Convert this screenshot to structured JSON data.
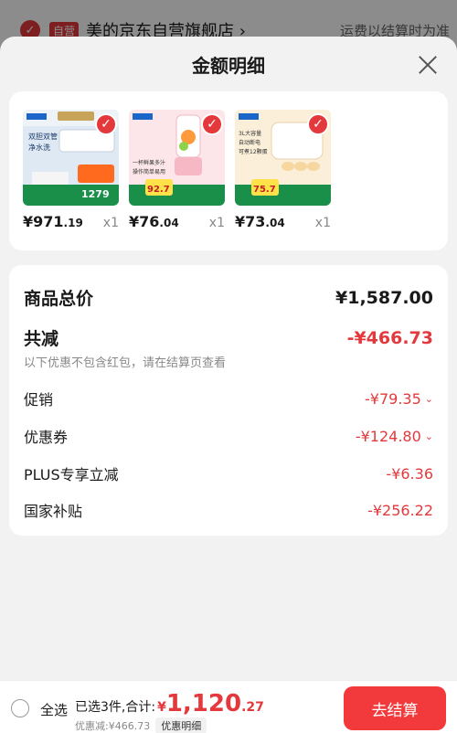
{
  "background": {
    "store_tag": "自营",
    "store_name": "美的京东自营旗舰店 ›",
    "shipping_note": "运费以结算时为准"
  },
  "sheet": {
    "title": "金额明细"
  },
  "products": [
    {
      "price_int": "¥971",
      "price_dec": ".19",
      "qty": "x1",
      "name": "electric-water-heater",
      "thumb_texts": [
        "双胆双管",
        "净水洗"
      ],
      "thumb_banner": "1279"
    },
    {
      "price_int": "¥76",
      "price_dec": ".04",
      "qty": "x1",
      "name": "juicer-cup",
      "thumb_texts": [
        "一杯鲜果多汁",
        "操作简单易用"
      ],
      "thumb_banner": "92.7"
    },
    {
      "price_int": "¥73",
      "price_dec": ".04",
      "qty": "x1",
      "name": "egg-steamer",
      "thumb_texts": [
        "3L大容量",
        "自动断电",
        "可煮12颗蛋"
      ],
      "thumb_banner": "75.7"
    }
  ],
  "summary": {
    "total_label": "商品总价",
    "total_value": "¥1,587.00",
    "reduce_label": "共减",
    "reduce_value": "-¥466.73",
    "hint": "以下优惠不包含红包，请在结算页查看",
    "items": [
      {
        "label": "促销",
        "value": "-¥79.35",
        "expand": "⌄"
      },
      {
        "label": "优惠券",
        "value": "-¥124.80",
        "expand": "⌄"
      },
      {
        "label": "PLUS专享立减",
        "value": "-¥6.36",
        "expand": ""
      },
      {
        "label": "国家补贴",
        "value": "-¥256.22",
        "expand": ""
      }
    ]
  },
  "bottom": {
    "select_all": "全选",
    "selected_text": "已选3件,合计:",
    "currency": "¥",
    "total_int": "1,120",
    "total_dec": ".27",
    "discount_text": "优惠减:¥466.73",
    "detail_label": "优惠明细",
    "checkout_label": "去结算"
  },
  "colors": {
    "accent": "#e4393c",
    "checkout": "#f23a3c"
  }
}
